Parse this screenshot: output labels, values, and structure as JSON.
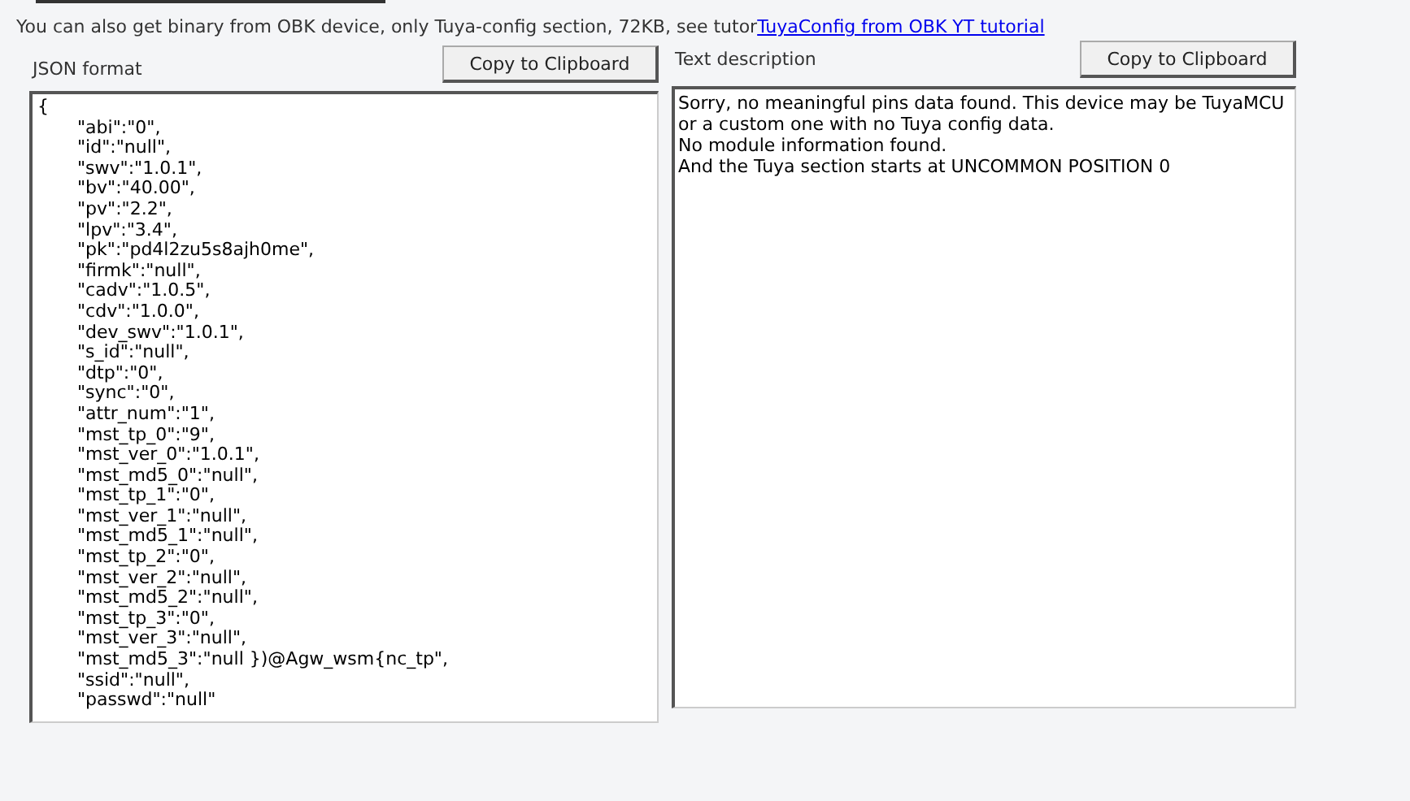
{
  "intro": {
    "text": "You can also get binary from OBK device, only Tuya-config section, 72KB, see tutor",
    "link": "TuyaConfig from OBK YT tutorial"
  },
  "panels": [
    {
      "kind": "json",
      "label": "JSON format",
      "button": "Copy to Clipboard",
      "lines": [
        "{",
        "\t\"abi\":\"0\",",
        "\t\"id\":\"null\",",
        "\t\"swv\":\"1.0.1\",",
        "\t\"bv\":\"40.00\",",
        "\t\"pv\":\"2.2\",",
        "\t\"lpv\":\"3.4\",",
        "\t\"pk\":\"pd4l2zu5s8ajh0me\",",
        "\t\"firmk\":\"null\",",
        "\t\"cadv\":\"1.0.5\",",
        "\t\"cdv\":\"1.0.0\",",
        "\t\"dev_swv\":\"1.0.1\",",
        "\t\"s_id\":\"null\",",
        "\t\"dtp\":\"0\",",
        "\t\"sync\":\"0\",",
        "\t\"attr_num\":\"1\",",
        "\t\"mst_tp_0\":\"9\",",
        "\t\"mst_ver_0\":\"1.0.1\",",
        "\t\"mst_md5_0\":\"null\",",
        "\t\"mst_tp_1\":\"0\",",
        "\t\"mst_ver_1\":\"null\",",
        "\t\"mst_md5_1\":\"null\",",
        "\t\"mst_tp_2\":\"0\",",
        "\t\"mst_ver_2\":\"null\",",
        "\t\"mst_md5_2\":\"null\",",
        "\t\"mst_tp_3\":\"0\",",
        "\t\"mst_ver_3\":\"null\",",
        "\t\"mst_md5_3\":\"null })@Agw_wsm{nc_tp\",",
        "\t\"ssid\":\"null\",",
        "\t\"passwd\":\"null\""
      ]
    },
    {
      "kind": "text",
      "label": "Text description",
      "button": "Copy to Clipboard",
      "lines": [
        "Sorry, no meaningful pins data found. This device may be TuyaMCU or a custom one with no Tuya config data.",
        "No module information found.",
        "And the Tuya section starts at UNCOMMON POSITION 0"
      ]
    }
  ]
}
